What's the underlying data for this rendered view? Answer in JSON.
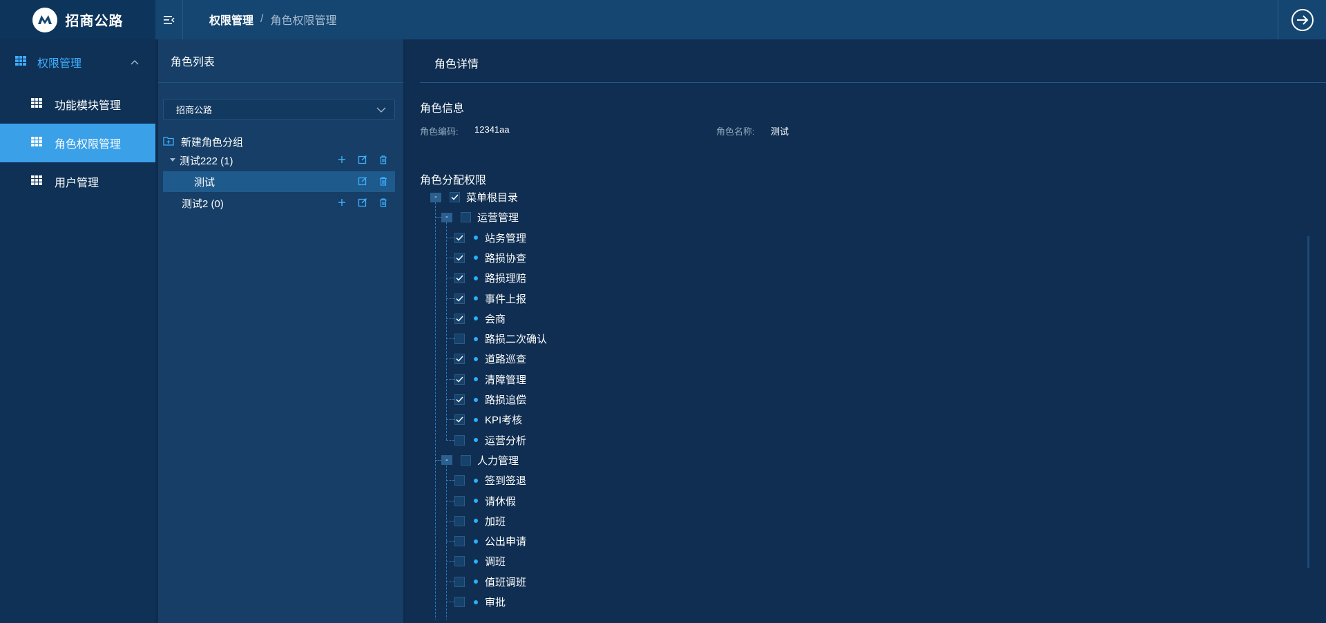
{
  "app": {
    "name": "招商公路"
  },
  "breadcrumb": {
    "first": "权限管理",
    "separator": "/",
    "second": "角色权限管理"
  },
  "sidebar": {
    "group": {
      "label": "权限管理"
    },
    "items": [
      {
        "label": "功能模块管理"
      },
      {
        "label": "角色权限管理"
      },
      {
        "label": "用户管理"
      }
    ]
  },
  "role_panel": {
    "title": "角色列表",
    "select_value": "招商公路",
    "new_group": "新建角色分组",
    "groups": [
      {
        "label": "测试222 (1)",
        "children": [
          {
            "label": "测试"
          }
        ]
      },
      {
        "label": "测试2 (0)"
      }
    ]
  },
  "detail": {
    "title": "角色详情",
    "info_title": "角色信息",
    "code_label": "角色编码:",
    "code_value": "12341aa",
    "name_label": "角色名称:",
    "name_value": "测试",
    "perm_title": "角色分配权限",
    "tree": {
      "root": {
        "label": "菜单根目录",
        "checked": true,
        "toggle": "-"
      },
      "ops": {
        "label": "运营管理",
        "checked": false,
        "toggle": "-",
        "items": [
          {
            "label": "站务管理",
            "checked": true
          },
          {
            "label": "路损协查",
            "checked": true
          },
          {
            "label": "路损理赔",
            "checked": true
          },
          {
            "label": "事件上报",
            "checked": true
          },
          {
            "label": "会商",
            "checked": true
          },
          {
            "label": "路损二次确认",
            "checked": false
          },
          {
            "label": "道路巡查",
            "checked": true
          },
          {
            "label": "清障管理",
            "checked": true
          },
          {
            "label": "路损追偿",
            "checked": true
          },
          {
            "label": "KPI考核",
            "checked": true
          },
          {
            "label": "运营分析",
            "checked": false
          }
        ]
      },
      "hr": {
        "label": "人力管理",
        "checked": false,
        "toggle": "-",
        "items": [
          {
            "label": "签到签退",
            "checked": false
          },
          {
            "label": "请休假",
            "checked": false
          },
          {
            "label": "加班",
            "checked": false
          },
          {
            "label": "公出申请",
            "checked": false
          },
          {
            "label": "调班",
            "checked": false
          },
          {
            "label": "值班调班",
            "checked": false
          },
          {
            "label": "审批",
            "checked": false
          }
        ]
      }
    }
  },
  "colors": {
    "accent": "#3aa1e8",
    "dot": "#2bb0ff",
    "header": "#154671"
  }
}
